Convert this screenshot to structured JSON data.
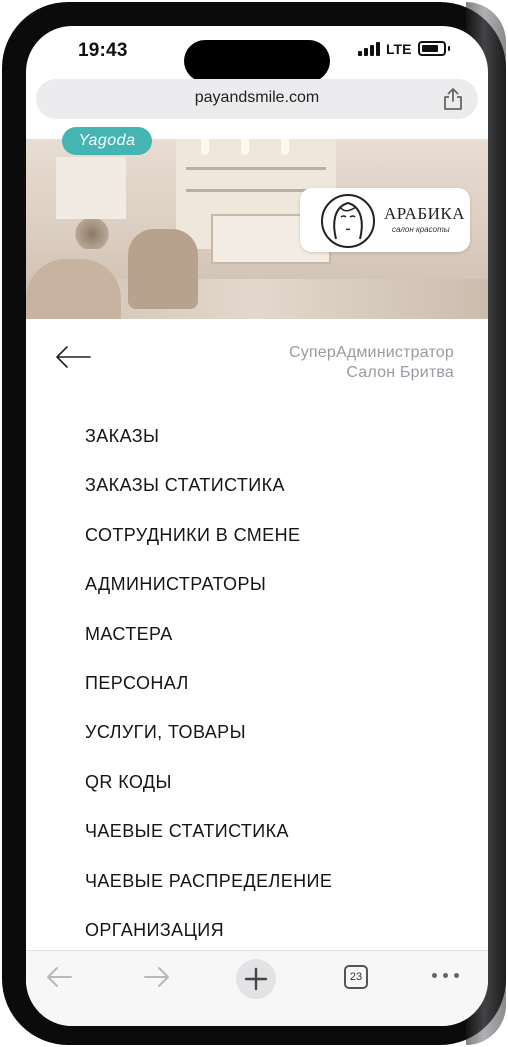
{
  "status_bar": {
    "time": "19:43",
    "network": "LTE"
  },
  "browser": {
    "url": "payandsmile.com",
    "tab_count": "23"
  },
  "banner": {
    "brand_badge": "Yagoda",
    "salon_logo_name": "АРАБИКА",
    "salon_logo_subtitle": "салон красоты"
  },
  "header": {
    "user_role": "СуперАдминистратор",
    "salon_name": "Салон Бритва"
  },
  "menu": {
    "items": [
      "ЗАКАЗЫ",
      "ЗАКАЗЫ СТАТИСТИКА",
      "СОТРУДНИКИ В СМЕНЕ",
      "АДМИНИСТРАТОРЫ",
      "МАСТЕРА",
      "ПЕРСОНАЛ",
      "УСЛУГИ, ТОВАРЫ",
      "QR КОДЫ",
      "ЧАЕВЫЕ СТАТИСТИКА",
      "ЧАЕВЫЕ РАСПРЕДЕЛЕНИЕ",
      "ОРГАНИЗАЦИЯ"
    ]
  },
  "icons": {
    "back": "arrow-left-icon",
    "share": "share-icon",
    "nav_back": "chevron-left-icon",
    "nav_forward": "chevron-right-icon",
    "new_tab": "plus-icon",
    "tabs": "tabs-icon",
    "more": "more-dots-icon"
  },
  "colors": {
    "brand_badge": "#45b5b4",
    "secondary_text": "#9a9aa2",
    "menu_text": "#151515"
  }
}
